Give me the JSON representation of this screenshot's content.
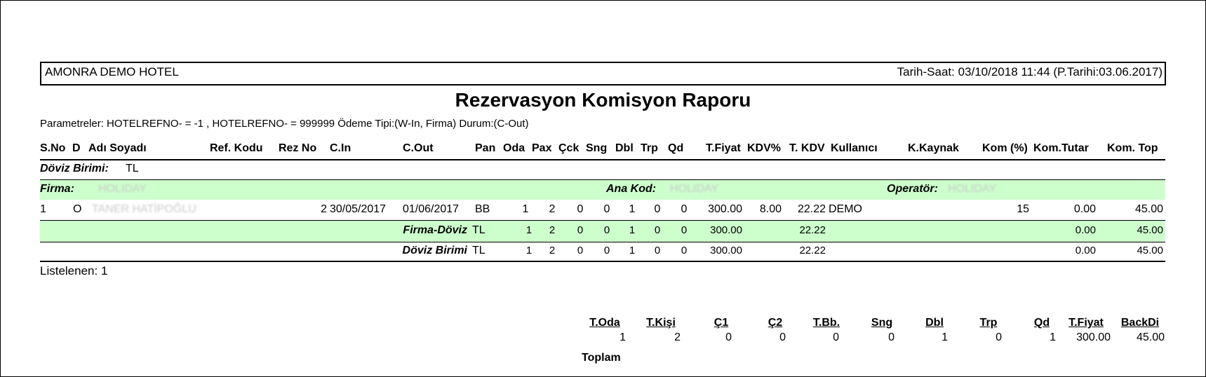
{
  "header": {
    "hotel": "AMONRA DEMO HOTEL",
    "datetime": "Tarih-Saat: 03/10/2018 11:44 (P.Tarihi:03.06.2017)"
  },
  "title": "Rezervasyon Komisyon Raporu",
  "parameters": "Parametreler: HOTELREFNO- = -1 , HOTELREFNO- = 999999  Ödeme Tipi:(W-In, Firma) Durum:(C-Out)",
  "columns": [
    "S.No",
    "D",
    "Adı Soyadı",
    "Ref. Kodu",
    "Rez No",
    "C.In",
    "C.Out",
    "Pan",
    "Oda",
    "Pax",
    "Çck",
    "Sng",
    "Dbl",
    "Trp",
    "Qd",
    "T.Fiyat",
    "KDV%",
    "T. KDV",
    "Kullanıcı",
    "K.Kaynak",
    "Kom (%)",
    "Kom.Tutar",
    "Kom. Top"
  ],
  "currency_group": {
    "label": "Döviz Birimi:",
    "value": "TL"
  },
  "firma_group": {
    "firma_label": "Firma:",
    "firma_value": "HOLIDAY",
    "ana_kod_label": "Ana Kod:",
    "ana_kod_value": "HOLIDAY",
    "operator_label": "Operatör:",
    "operator_value": "HOLIDAY"
  },
  "row": {
    "sno": "1",
    "d": "O",
    "name": "TANER HATİPOĞLU",
    "rezno": "2",
    "cin": "30/05/2017",
    "cout": "01/06/2017",
    "pan": "BB",
    "oda": "1",
    "pax": "2",
    "cck": "0",
    "sng": "0",
    "dbl": "1",
    "trp": "0",
    "qd": "0",
    "tfiyat": "300.00",
    "kdv": "8.00",
    "tkdv": "22.22",
    "user": "DEMO",
    "kom_pct": "15",
    "kom_tutar": "0.00",
    "kom_top": "45.00"
  },
  "firma_doviz": {
    "label": "Firma-Döviz",
    "cur": "TL",
    "oda": "1",
    "pax": "2",
    "cck": "0",
    "sng": "0",
    "dbl": "1",
    "trp": "0",
    "qd": "0",
    "tfiyat": "300.00",
    "tkdv": "22.22",
    "kom_tutar": "0.00",
    "kom_top": "45.00"
  },
  "doviz_birimi": {
    "label": "Döviz Birimi",
    "cur": "TL",
    "oda": "1",
    "pax": "2",
    "cck": "0",
    "sng": "0",
    "dbl": "1",
    "trp": "0",
    "qd": "0",
    "tfiyat": "300.00",
    "tkdv": "22.22",
    "kom_tutar": "0.00",
    "kom_top": "45.00"
  },
  "listed": "Listelenen: 1",
  "summary": {
    "headers": [
      "T.Oda",
      "T.Kişi",
      "Ç1",
      "Ç2",
      "T.Bb.",
      "Sng",
      "Dbl",
      "Trp",
      "Qd",
      "T.Fiyat",
      "BackDi"
    ],
    "values": [
      "1",
      "2",
      "0",
      "0",
      "0",
      "0",
      "1",
      "0",
      "1",
      "300.00",
      "45.00"
    ],
    "total_label": "Toplam"
  }
}
